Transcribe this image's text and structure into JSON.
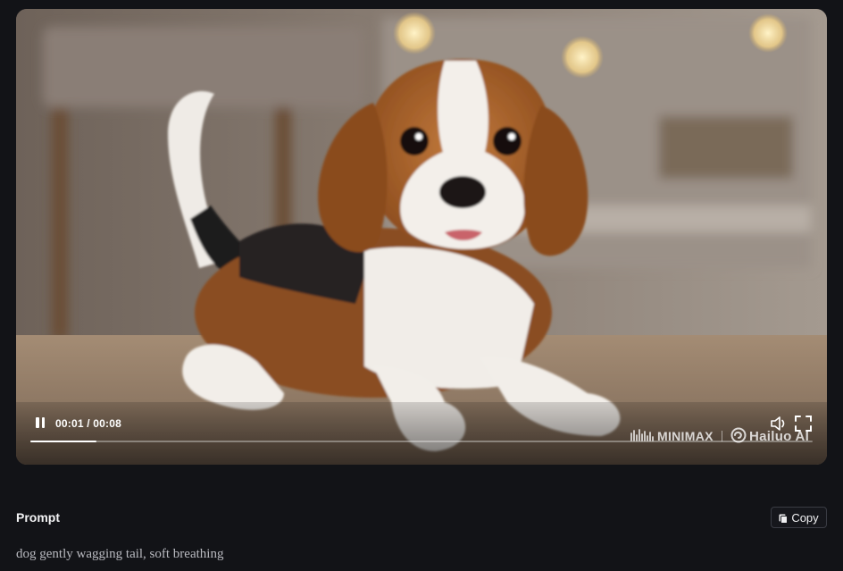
{
  "video": {
    "time_display": "00:01 / 00:08",
    "progress_fraction": 0.085,
    "state": "playing",
    "watermark": {
      "left": "MINIMAX",
      "right": "Hailuo AI"
    },
    "scene_description_icon": "video-frame"
  },
  "prompt": {
    "title": "Prompt",
    "copy_label": "Copy",
    "text": "dog gently wagging tail, soft breathing"
  }
}
